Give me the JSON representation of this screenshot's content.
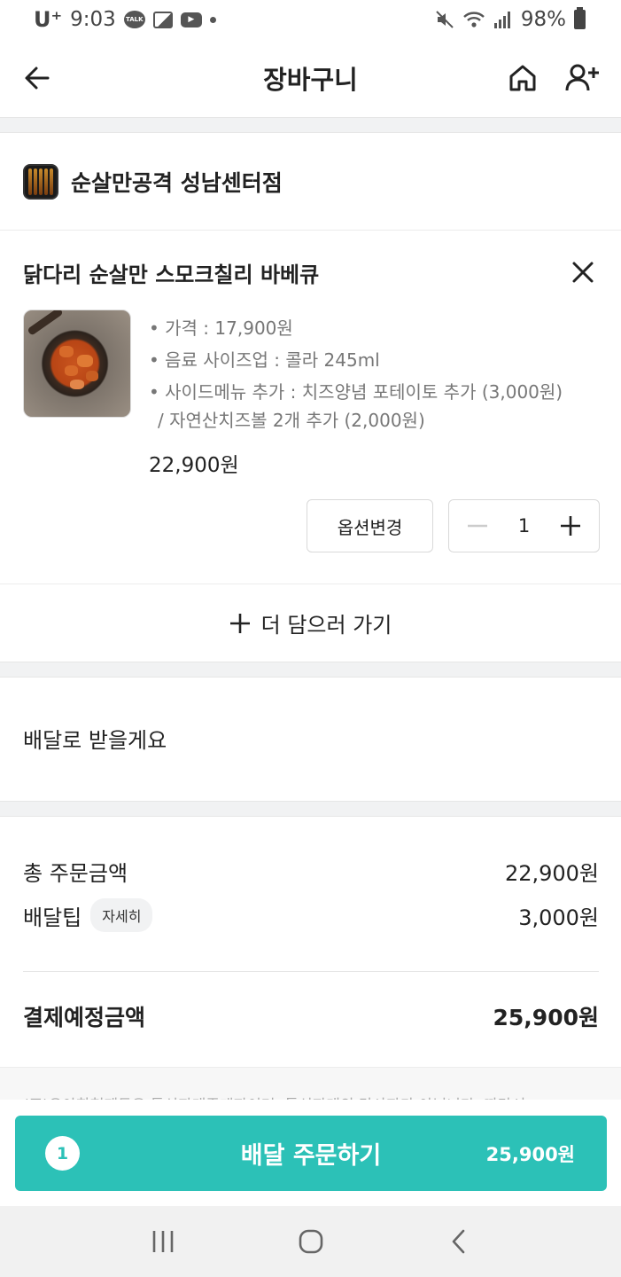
{
  "status_bar": {
    "carrier": "U⁺",
    "time": "9:03",
    "battery": "98%",
    "talk_label": "TALK"
  },
  "header": {
    "title": "장바구니"
  },
  "store": {
    "name": "순살만공격 성남센터점"
  },
  "cart_item": {
    "name": "닭다리 순살만 스모크칠리 바베큐",
    "options": [
      "• 가격 : 17,900원",
      "• 음료 사이즈업 : 콜라 245ml",
      "• 사이드메뉴 추가 : 치즈양념 포테이토 추가 (3,000원)"
    ],
    "options_cont": "/ 자연산치즈볼 2개 추가 (2,000원)",
    "price": "22,900원",
    "option_change_label": "옵션변경",
    "quantity": "1"
  },
  "add_more": {
    "label": "더 담으러 가기"
  },
  "delivery": {
    "label": "배달로 받을게요"
  },
  "summary": {
    "total_label": "총 주문금액",
    "total_value": "22,900원",
    "tip_label": "배달팁",
    "tip_detail_label": "자세히",
    "tip_value": "3,000원",
    "pay_label": "결제예정금액",
    "pay_value": "25,900원"
  },
  "notice": {
    "text": "(주)우아한형제들은 통신판매중개자이며, 통신판매의 당사자가 아닙니다. 따라서"
  },
  "order_button": {
    "count": "1",
    "label": "배달 주문하기",
    "amount": "25,900원"
  },
  "colors": {
    "accent": "#2cc1b7",
    "band": "#f1f2f3"
  }
}
